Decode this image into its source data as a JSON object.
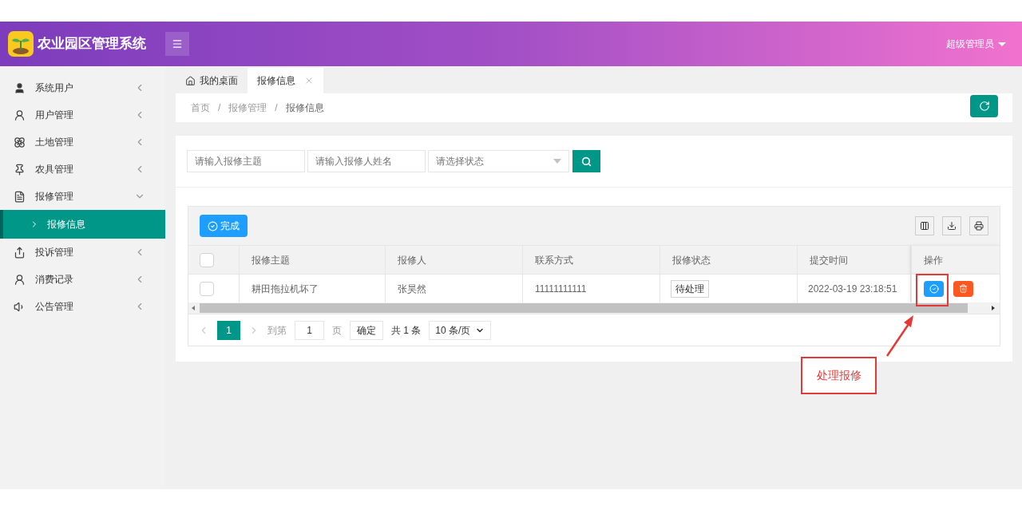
{
  "header": {
    "app_title": "农业园区管理系统",
    "user": "超级管理员"
  },
  "sidebar": {
    "items": [
      {
        "label": "系统用户",
        "expanded": false
      },
      {
        "label": "用户管理",
        "expanded": false
      },
      {
        "label": "土地管理",
        "expanded": false
      },
      {
        "label": "农具管理",
        "expanded": false
      },
      {
        "label": "报修管理",
        "expanded": true,
        "children": [
          {
            "label": "报修信息",
            "selected": true
          }
        ]
      },
      {
        "label": "投诉管理",
        "expanded": false
      },
      {
        "label": "消费记录",
        "expanded": false
      },
      {
        "label": "公告管理",
        "expanded": false
      }
    ]
  },
  "tabs": [
    {
      "label": "我的桌面",
      "selected": false,
      "closable": false
    },
    {
      "label": "报修信息",
      "selected": true,
      "closable": true
    }
  ],
  "breadcrumb": {
    "separator": "/",
    "items": [
      "首页",
      "报修管理",
      "报修信息"
    ]
  },
  "search": {
    "fields": [
      {
        "placeholder": "请输入报修主题"
      },
      {
        "placeholder": "请输入报修人姓名"
      }
    ],
    "status_select": {
      "placeholder": "请选择状态"
    }
  },
  "toolbar": {
    "complete_button": "完成"
  },
  "table": {
    "columns": [
      "报修主题",
      "报修人",
      "联系方式",
      "报修状态",
      "提交时间",
      "操作"
    ],
    "rows": [
      {
        "checked": false,
        "subject": "耕田拖拉机坏了",
        "reporter": "张昊然",
        "contact": "11111111111",
        "status": "待处理",
        "time": "2022-03-19 23:18:51"
      }
    ],
    "header_checked": false
  },
  "pagination": {
    "pages": [
      {
        "label": "1",
        "selected": true
      }
    ],
    "goto_label": "到第",
    "goto_value": "1",
    "page_unit": "页",
    "confirm": "确定",
    "total": "共 1 条",
    "page_size": "10 条/页"
  },
  "annotation": {
    "label": "处理报修"
  }
}
